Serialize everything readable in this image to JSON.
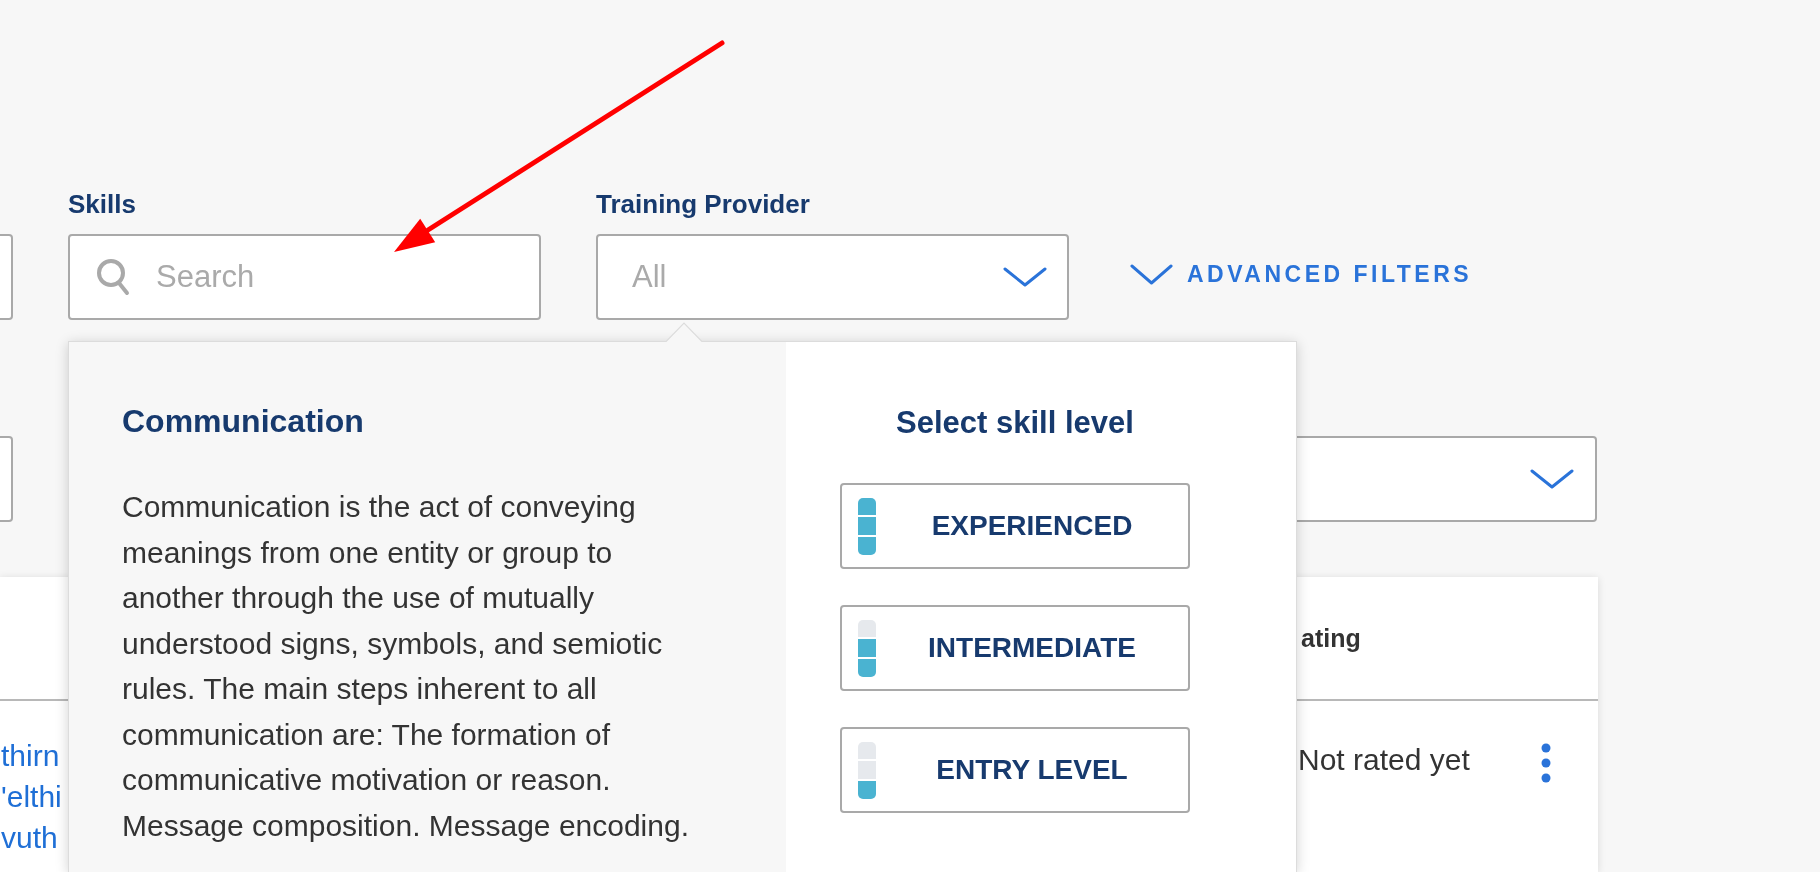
{
  "annotations": [
    {
      "kind": "arrow"
    }
  ],
  "filter_rows": [
    {
      "fields": [
        {
          "kind": "partial"
        },
        {
          "kind": "search",
          "label": "Skills",
          "placeholder": "Search"
        },
        {
          "kind": "select",
          "label": "Training Provider",
          "placeholder": "All"
        }
      ],
      "advanced_filters": {
        "label": "ADVANCED FILTERS",
        "expanded": false
      }
    },
    {
      "fields": [
        {
          "kind": "partial"
        },
        {
          "kind": "partial_select"
        }
      ]
    }
  ],
  "table": {
    "header": "ating",
    "rows": [
      {
        "column_1": [
          "thirn",
          "'elthi",
          "vuth"
        ],
        "rating": "Not rated yet"
      }
    ]
  },
  "skill_popover": {
    "title": "Communication",
    "description": "Communication is the act of conveying\nmeanings from one entity or group to\nanother through the use of mutually\nunderstood signs, symbols, and semiotic\nrules. The main steps inherent to all\ncommunication are: The formation of\ncommunicative motivation or reason.\nMessage composition. Message encoding.",
    "level_heading": "Select skill level",
    "levels": [
      {
        "label": "EXPERIENCED",
        "level": 1
      },
      {
        "label": "INTERMEDIATE",
        "level": 0.67
      },
      {
        "label": "ENTRY LEVEL",
        "level": 0.33
      }
    ]
  }
}
